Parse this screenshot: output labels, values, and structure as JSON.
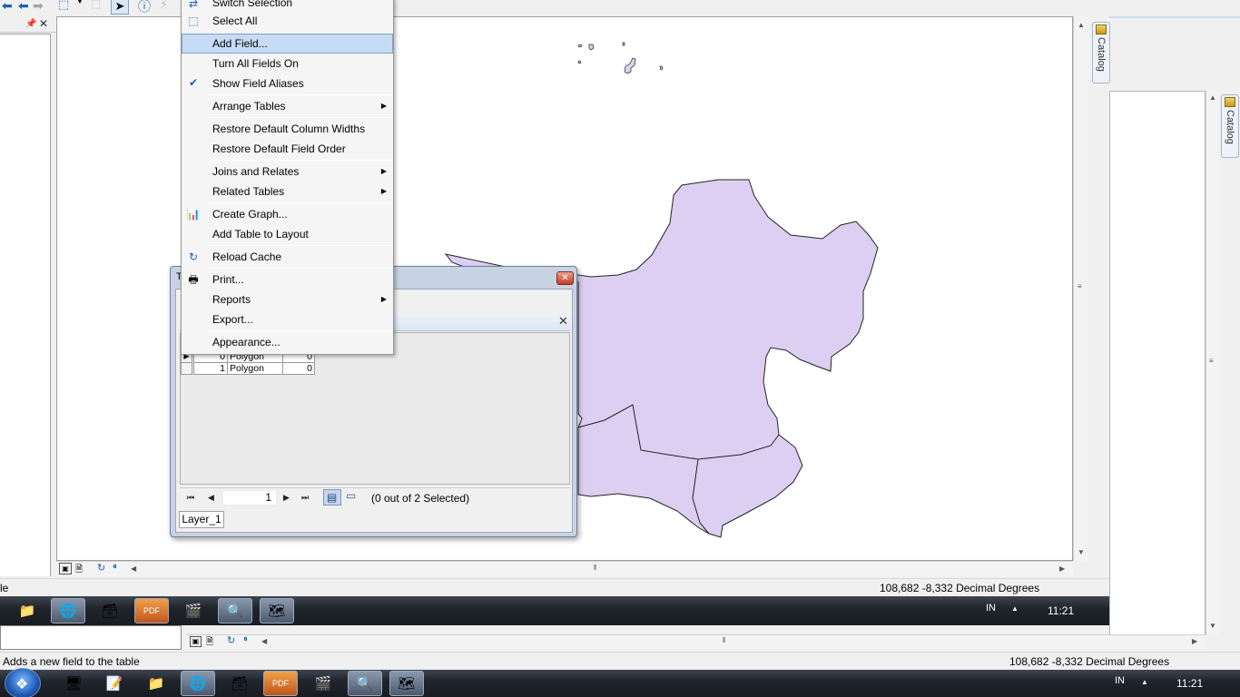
{
  "context_menu": {
    "items": [
      {
        "label": "Switch Selection"
      },
      {
        "label": "Select All"
      },
      {
        "label": "Add Field..."
      },
      {
        "label": "Turn All Fields On"
      },
      {
        "label": "Show Field Aliases"
      },
      {
        "label": "Arrange Tables"
      },
      {
        "label": "Restore Default Column Widths"
      },
      {
        "label": "Restore Default Field Order"
      },
      {
        "label": "Joins and Relates"
      },
      {
        "label": "Related Tables"
      },
      {
        "label": "Create Graph..."
      },
      {
        "label": "Add Table to Layout"
      },
      {
        "label": "Reload Cache"
      },
      {
        "label": "Print..."
      },
      {
        "label": "Reports"
      },
      {
        "label": "Export..."
      },
      {
        "label": "Appearance..."
      }
    ],
    "highlighted": "Add Field...",
    "checked": "Show Field Aliases"
  },
  "table_window": {
    "title_fragment": "T",
    "rows": [
      {
        "fid": "0",
        "shape": "Polygon",
        "id": "0"
      },
      {
        "fid": "1",
        "shape": "Polygon",
        "id": "0"
      }
    ],
    "nav": {
      "page": "1",
      "selected_status": "(0 out of 2 Selected)"
    },
    "layer_tab": "Layer_1"
  },
  "panels": {
    "catalog_tab": "Catalog",
    "catalog_tab_2": "Catalog"
  },
  "status": {
    "fg_left_fragment": "le",
    "fg_coords": "108,682  -8,332 Decimal Degrees",
    "bg_message": "Adds a new field to the table",
    "bg_coords": "108,682  -8,332 Decimal Degrees"
  },
  "taskbar": {
    "fg_lang": "IN",
    "fg_time": "11:21",
    "main_lang": "IN",
    "main_time": "11:21"
  },
  "colors": {
    "polygon_fill": "#dccff2",
    "menu_highlight": "#c6dcf5",
    "taskbar": "#1f242b"
  }
}
